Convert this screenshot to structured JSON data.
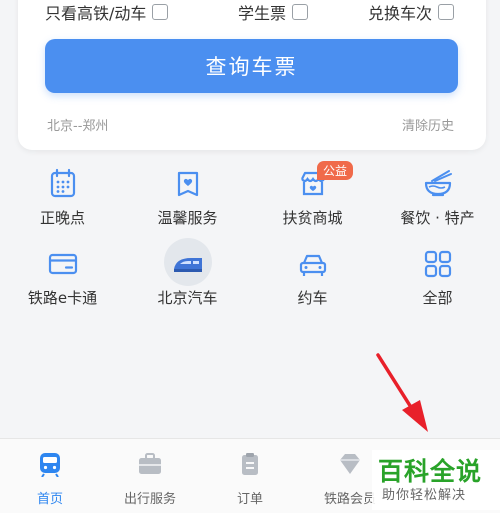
{
  "search_card": {
    "options": [
      {
        "label": "只看高铁/动车"
      },
      {
        "label": "学生票"
      },
      {
        "label": "兑换车次"
      }
    ],
    "query_button": "查询车票",
    "history_route": "北京--郑州",
    "clear_history": "清除历史"
  },
  "services": [
    {
      "label": "正晚点",
      "icon": "calendar-icon"
    },
    {
      "label": "温馨服务",
      "icon": "heart-box-icon"
    },
    {
      "label": "扶贫商城",
      "icon": "shop-icon",
      "badge": "公益"
    },
    {
      "label": "餐饮 · 特产",
      "icon": "food-bowl-icon"
    },
    {
      "label": "铁路e卡通",
      "icon": "card-icon"
    },
    {
      "label": "北京汽车",
      "icon": "train-icon"
    },
    {
      "label": "约车",
      "icon": "car-icon"
    },
    {
      "label": "全部",
      "icon": "grid-icon"
    }
  ],
  "tabs": [
    {
      "label": "首页",
      "icon": "home-train-icon",
      "active": true
    },
    {
      "label": "出行服务",
      "icon": "briefcase-icon"
    },
    {
      "label": "订单",
      "icon": "clipboard-icon"
    },
    {
      "label": "铁路会员",
      "icon": "diamond-icon"
    }
  ],
  "watermark": {
    "title": "百科全说",
    "subtitle": "助你轻松解决"
  },
  "colors": {
    "accent": "#4b8ff0",
    "active_tab": "#2e86f0",
    "annotation_arrow": "#e8202a",
    "watermark": "#29a329"
  }
}
